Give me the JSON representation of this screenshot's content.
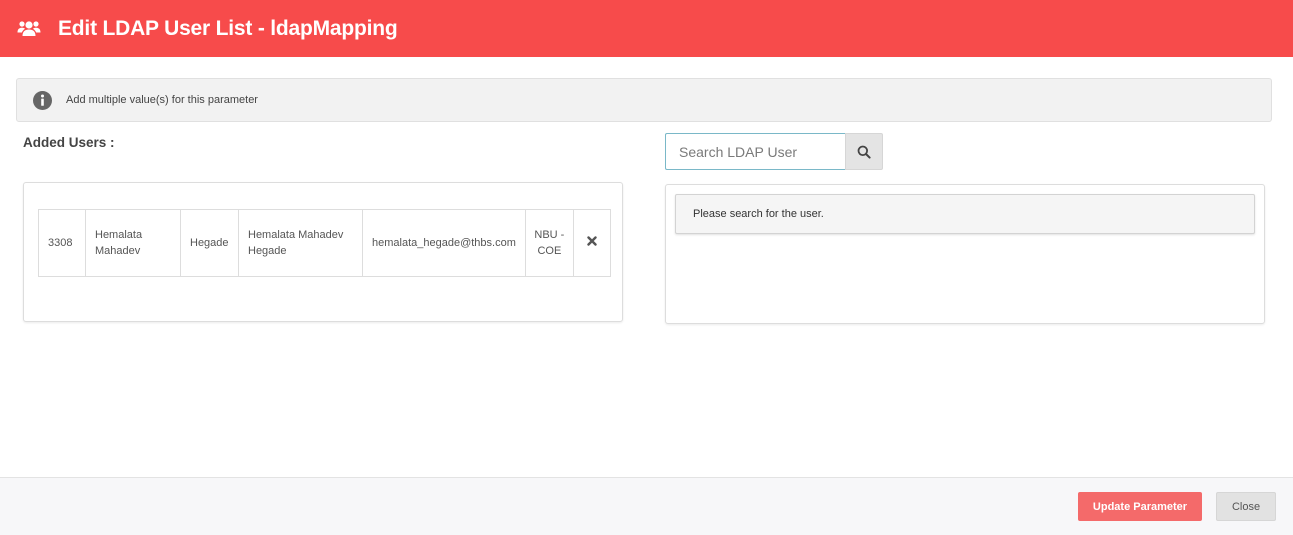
{
  "header": {
    "title": "Edit LDAP User List - ldapMapping",
    "icon": "users-icon",
    "background": "#f74b4b"
  },
  "info": {
    "icon": "info-circle-icon",
    "text": "Add multiple value(s) for this parameter"
  },
  "added_users": {
    "label": "Added Users :",
    "rows": [
      {
        "id": "3308",
        "first_name": "Hemalata Mahadev",
        "last_name": "Hegade",
        "full_name": "Hemalata Mahadev Hegade",
        "email": "hemalata_hegade@thbs.com",
        "department": "NBU - COE",
        "remove_icon": "remove-x-icon"
      }
    ]
  },
  "search": {
    "placeholder": "Search LDAP User",
    "value": "",
    "button_icon": "search-icon",
    "result_message": "Please search for the user."
  },
  "footer": {
    "update_label": "Update Parameter",
    "close_label": "Close",
    "update_color": "#f46a6a"
  }
}
